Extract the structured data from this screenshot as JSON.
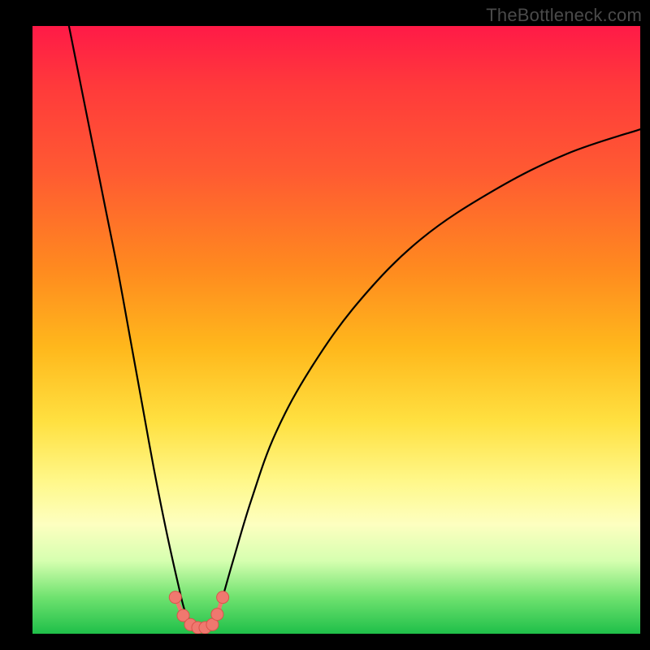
{
  "watermark": "TheBottleneck.com",
  "colors": {
    "frame": "#000000",
    "gradient_top": "#ff1a47",
    "gradient_mid": "#ffe040",
    "gradient_bottom": "#1fbf49",
    "curve": "#000000",
    "marker_fill": "#f0786f",
    "marker_stroke": "#da544b"
  },
  "chart_data": {
    "type": "line",
    "title": "",
    "xlabel": "",
    "ylabel": "",
    "xlim": [
      0,
      100
    ],
    "ylim": [
      0,
      100
    ],
    "grid": false,
    "legend": false,
    "note": "Axes are unlabeled; values are normalized 0–100 estimates from pixel positions.",
    "series": [
      {
        "name": "left-branch",
        "x": [
          6,
          8,
          10,
          12,
          14,
          16,
          18,
          20,
          22,
          24,
          25,
          26
        ],
        "y": [
          100,
          90,
          80,
          70,
          60,
          49,
          38,
          27,
          17,
          8,
          4,
          2
        ]
      },
      {
        "name": "right-branch",
        "x": [
          30,
          31,
          33,
          36,
          40,
          46,
          54,
          64,
          76,
          88,
          100
        ],
        "y": [
          2,
          5,
          12,
          22,
          33,
          44,
          55,
          65,
          73,
          79,
          83
        ]
      }
    ],
    "markers": {
      "name": "bottom-cluster",
      "x": [
        23.5,
        24.8,
        26.0,
        27.2,
        28.4,
        29.6,
        30.4,
        31.3
      ],
      "y": [
        6.0,
        3.0,
        1.5,
        1.0,
        1.0,
        1.5,
        3.2,
        6.0
      ]
    }
  }
}
